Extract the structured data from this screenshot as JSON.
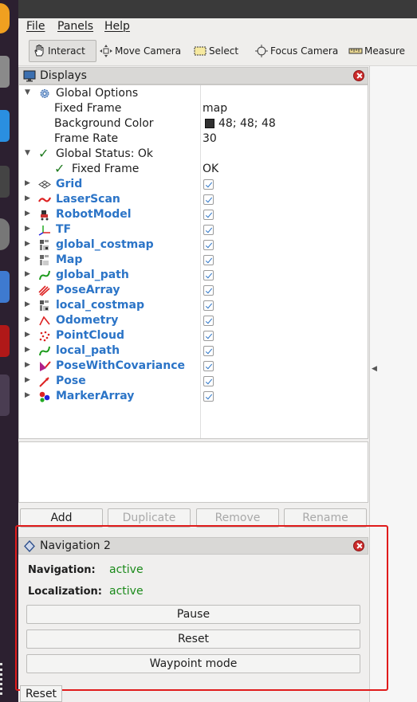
{
  "menubar": {
    "items": [
      "File",
      "Panels",
      "Help"
    ]
  },
  "toolbar": {
    "tools": [
      {
        "label": "Interact",
        "icon": "hand-icon"
      },
      {
        "label": "Move Camera",
        "icon": "move-camera-icon"
      },
      {
        "label": "Select",
        "icon": "select-box-icon"
      },
      {
        "label": "Focus Camera",
        "icon": "focus-camera-icon"
      },
      {
        "label": "Measure",
        "icon": "ruler-icon"
      }
    ]
  },
  "displays_panel": {
    "title": "Displays",
    "global_options": {
      "label": "Global Options",
      "fixed_frame_label": "Fixed Frame",
      "fixed_frame_value": "map",
      "background_color_label": "Background Color",
      "background_color_value": "48; 48; 48",
      "background_color_hex": "#303030",
      "frame_rate_label": "Frame Rate",
      "frame_rate_value": "30"
    },
    "global_status": {
      "label": "Global Status: Ok",
      "fixed_frame_label": "Fixed Frame",
      "fixed_frame_value": "OK"
    },
    "displays": [
      {
        "label": "Grid",
        "icon": "grid-icon",
        "enabled": true
      },
      {
        "label": "LaserScan",
        "icon": "laserscan-icon",
        "enabled": true
      },
      {
        "label": "RobotModel",
        "icon": "robot-model-icon",
        "enabled": true
      },
      {
        "label": "TF",
        "icon": "tf-axes-icon",
        "enabled": true
      },
      {
        "label": "global_costmap",
        "icon": "costmap-icon",
        "enabled": true
      },
      {
        "label": "Map",
        "icon": "map-icon",
        "enabled": true
      },
      {
        "label": "global_path",
        "icon": "path-icon",
        "enabled": true
      },
      {
        "label": "PoseArray",
        "icon": "pose-array-icon",
        "enabled": true
      },
      {
        "label": "local_costmap",
        "icon": "costmap-icon",
        "enabled": true
      },
      {
        "label": "Odometry",
        "icon": "odometry-icon",
        "enabled": true
      },
      {
        "label": "PointCloud",
        "icon": "pointcloud-icon",
        "enabled": true
      },
      {
        "label": "local_path",
        "icon": "path-icon",
        "enabled": true
      },
      {
        "label": "PoseWithCovariance",
        "icon": "pose-covariance-icon",
        "enabled": true
      },
      {
        "label": "Pose",
        "icon": "pose-arrow-icon",
        "enabled": true
      },
      {
        "label": "MarkerArray",
        "icon": "marker-array-icon",
        "enabled": true
      }
    ],
    "buttons": {
      "add": "Add",
      "duplicate": "Duplicate",
      "remove": "Remove",
      "rename": "Rename"
    }
  },
  "navigation_panel": {
    "title": "Navigation 2",
    "navigation_label": "Navigation:",
    "navigation_value": "active",
    "localization_label": "Localization:",
    "localization_value": "active",
    "pause_button": "Pause",
    "reset_button": "Reset",
    "waypoint_button": "Waypoint mode"
  },
  "bottom": {
    "reset_button": "Reset"
  },
  "colors": {
    "display_label": "#2b74c7",
    "status_active": "#1a8a1a",
    "highlight": "#e01b1b"
  }
}
